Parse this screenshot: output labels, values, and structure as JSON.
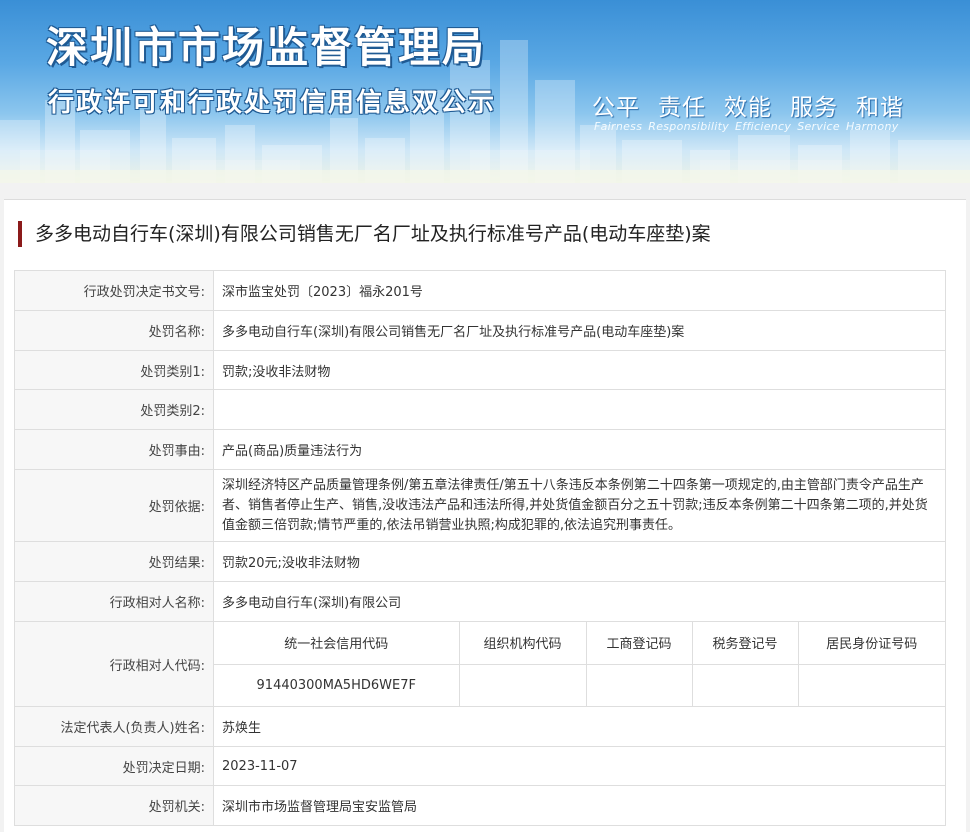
{
  "banner": {
    "title": "深圳市市场监督管理局",
    "subtitle": "行政许可和行政处罚信用信息双公示",
    "slogans": [
      "公平",
      "责任",
      "效能",
      "服务",
      "和谐"
    ],
    "slogans_en": [
      "Fairness",
      "Responsibility",
      "Efficiency",
      "Service",
      "Harmony"
    ]
  },
  "case_title": "多多电动自行车(深圳)有限公司销售无厂名厂址及执行标准号产品(电动车座垫)案",
  "fields": {
    "decision_no": {
      "label": "行政处罚决定书文号:",
      "value": "深市监宝处罚〔2023〕福永201号"
    },
    "penalty_name": {
      "label": "处罚名称:",
      "value": "多多电动自行车(深圳)有限公司销售无厂名厂址及执行标准号产品(电动车座垫)案"
    },
    "category1": {
      "label": "处罚类别1:",
      "value": "罚款;没收非法财物"
    },
    "category2": {
      "label": "处罚类别2:",
      "value": ""
    },
    "reason": {
      "label": "处罚事由:",
      "value": "产品(商品)质量违法行为"
    },
    "basis": {
      "label": "处罚依据:",
      "value": "深圳经济特区产品质量管理条例/第五章法律责任/第五十八条违反本条例第二十四条第一项规定的,由主管部门责令产品生产者、销售者停止生产、销售,没收违法产品和违法所得,并处货值金额百分之五十罚款;违反本条例第二十四条第二项的,并处货值金额三倍罚款;情节严重的,依法吊销营业执照;构成犯罪的,依法追究刑事责任。"
    },
    "result": {
      "label": "处罚结果:",
      "value": "罚款20元;没收非法财物"
    },
    "party_name": {
      "label": "行政相对人名称:",
      "value": "多多电动自行车(深圳)有限公司"
    },
    "party_code": {
      "label": "行政相对人代码:",
      "headers": [
        "统一社会信用代码",
        "组织机构代码",
        "工商登记码",
        "税务登记号",
        "居民身份证号码"
      ],
      "values": [
        "91440300MA5HD6WE7F",
        "",
        "",
        "",
        ""
      ]
    },
    "legal_rep": {
      "label": "法定代表人(负责人)姓名:",
      "value": "苏焕生"
    },
    "decision_date": {
      "label": "处罚决定日期:",
      "value": "2023-11-07"
    },
    "authority": {
      "label": "处罚机关:",
      "value": "深圳市市场监督管理局宝安监管局"
    }
  }
}
